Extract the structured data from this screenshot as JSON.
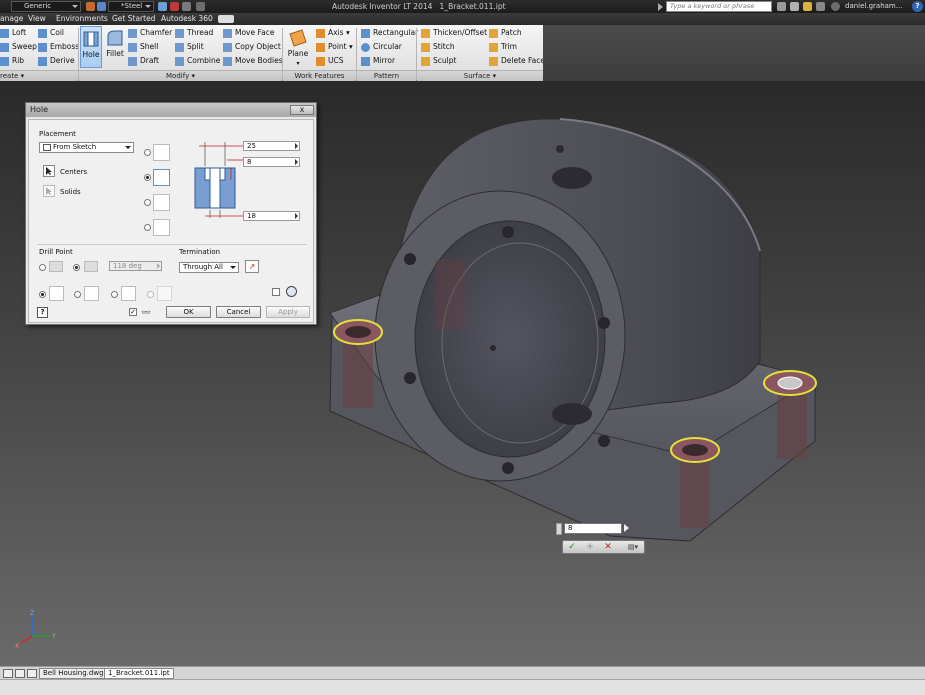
{
  "titlebar": {
    "style_combo": "Generic",
    "material_combo": "*Steel",
    "app_title": "Autodesk Inventor LT 2014",
    "file_title": "1_Bracket.011.ipt",
    "search_placeholder": "Type a keyword or phrase",
    "user": "daniel.graham...",
    "help": "?"
  },
  "tabs": [
    "anage",
    "View",
    "Environments",
    "Get Started",
    "Autodesk 360"
  ],
  "ribbon": {
    "create": {
      "items": [
        "Loft",
        "Sweep",
        "Rib",
        "Coil",
        "Emboss",
        "Derive"
      ],
      "label": "reate"
    },
    "modify": {
      "hole": "Hole",
      "fillet": "Fillet",
      "items": [
        "Chamfer",
        "Shell",
        "Draft",
        "Thread",
        "Split",
        "Combine",
        "Move Face",
        "Copy Object",
        "Move Bodies"
      ],
      "label": "Modify"
    },
    "work_features": {
      "plane": "Plane",
      "items": [
        "Axis",
        "Point",
        "UCS"
      ],
      "label": "Work Features"
    },
    "pattern": {
      "items": [
        "Rectangular",
        "Circular",
        "Mirror"
      ],
      "label": "Pattern"
    },
    "surface": {
      "items": [
        "Thicken/Offset",
        "Stitch",
        "Sculpt",
        "Patch",
        "Trim",
        "Delete Face"
      ],
      "label": "Surface"
    }
  },
  "hole_dialog": {
    "title": "Hole",
    "close": "x",
    "placement_label": "Placement",
    "placement_value": "From Sketch",
    "centers": "Centers",
    "solids": "Solids",
    "dims": {
      "counterbore_diameter": "25",
      "counterbore_depth": "8",
      "hole_diameter": "18"
    },
    "drill_point_label": "Drill Point",
    "drill_angle": "118 deg",
    "termination_label": "Termination",
    "termination_value": "Through All",
    "ok": "OK",
    "cancel": "Cancel",
    "apply": "Apply"
  },
  "mini_toolbar": {
    "value": "8"
  },
  "doc_tabs": [
    "Bell Housing.dwg",
    "1_Bracket.011.ipt"
  ],
  "triad": {
    "x": "X",
    "y": "Y",
    "z": "Z"
  }
}
